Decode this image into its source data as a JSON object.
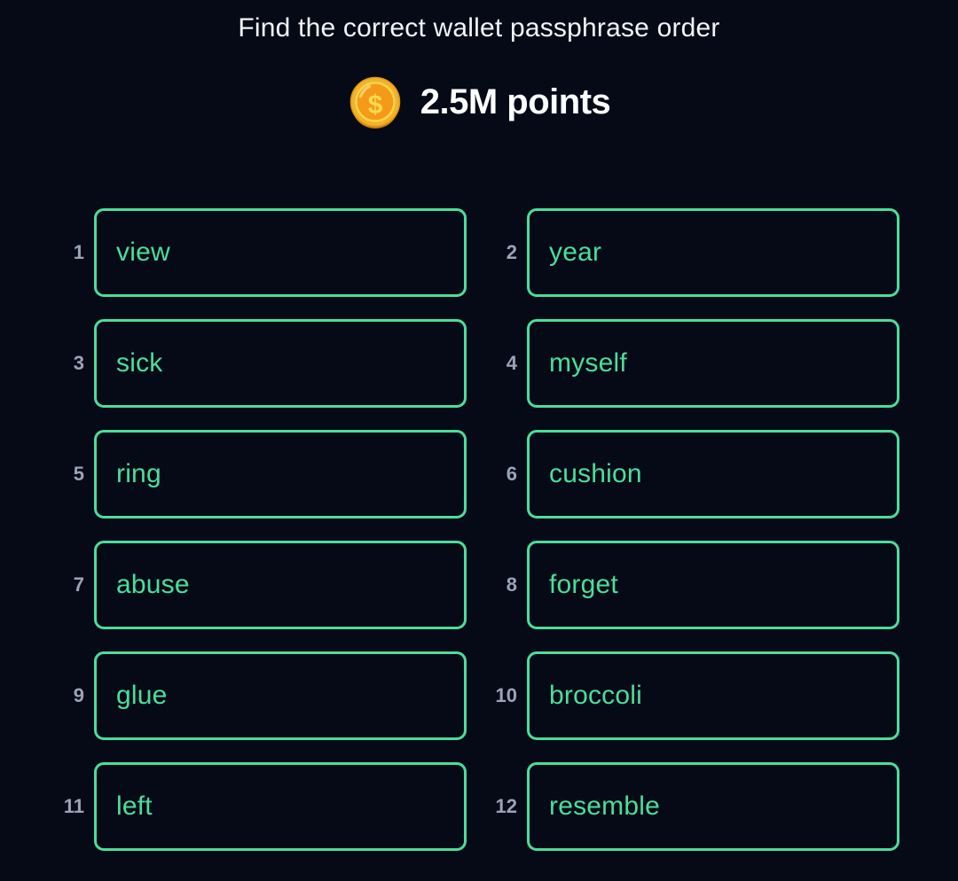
{
  "header": {
    "title": "Find the correct wallet passphrase order",
    "points_label": "2.5M points",
    "coin_icon": "gold-coin-dollar-icon"
  },
  "colors": {
    "background": "#060a17",
    "accent_green": "#4ade9a",
    "index_gray": "#9aa3b8",
    "title_white": "#f2f4f8",
    "coin_gold": "#f5a623",
    "coin_gold_light": "#fdd43f",
    "coin_gold_dark": "#e08a13"
  },
  "word_grid": {
    "columns": 2,
    "rows": 6,
    "total_words": 12,
    "items": [
      {
        "index": "1",
        "word": "view"
      },
      {
        "index": "2",
        "word": "year"
      },
      {
        "index": "3",
        "word": "sick"
      },
      {
        "index": "4",
        "word": "myself"
      },
      {
        "index": "5",
        "word": "ring"
      },
      {
        "index": "6",
        "word": "cushion"
      },
      {
        "index": "7",
        "word": "abuse"
      },
      {
        "index": "8",
        "word": "forget"
      },
      {
        "index": "9",
        "word": "glue"
      },
      {
        "index": "10",
        "word": "broccoli"
      },
      {
        "index": "11",
        "word": "left"
      },
      {
        "index": "12",
        "word": "resemble"
      }
    ]
  }
}
